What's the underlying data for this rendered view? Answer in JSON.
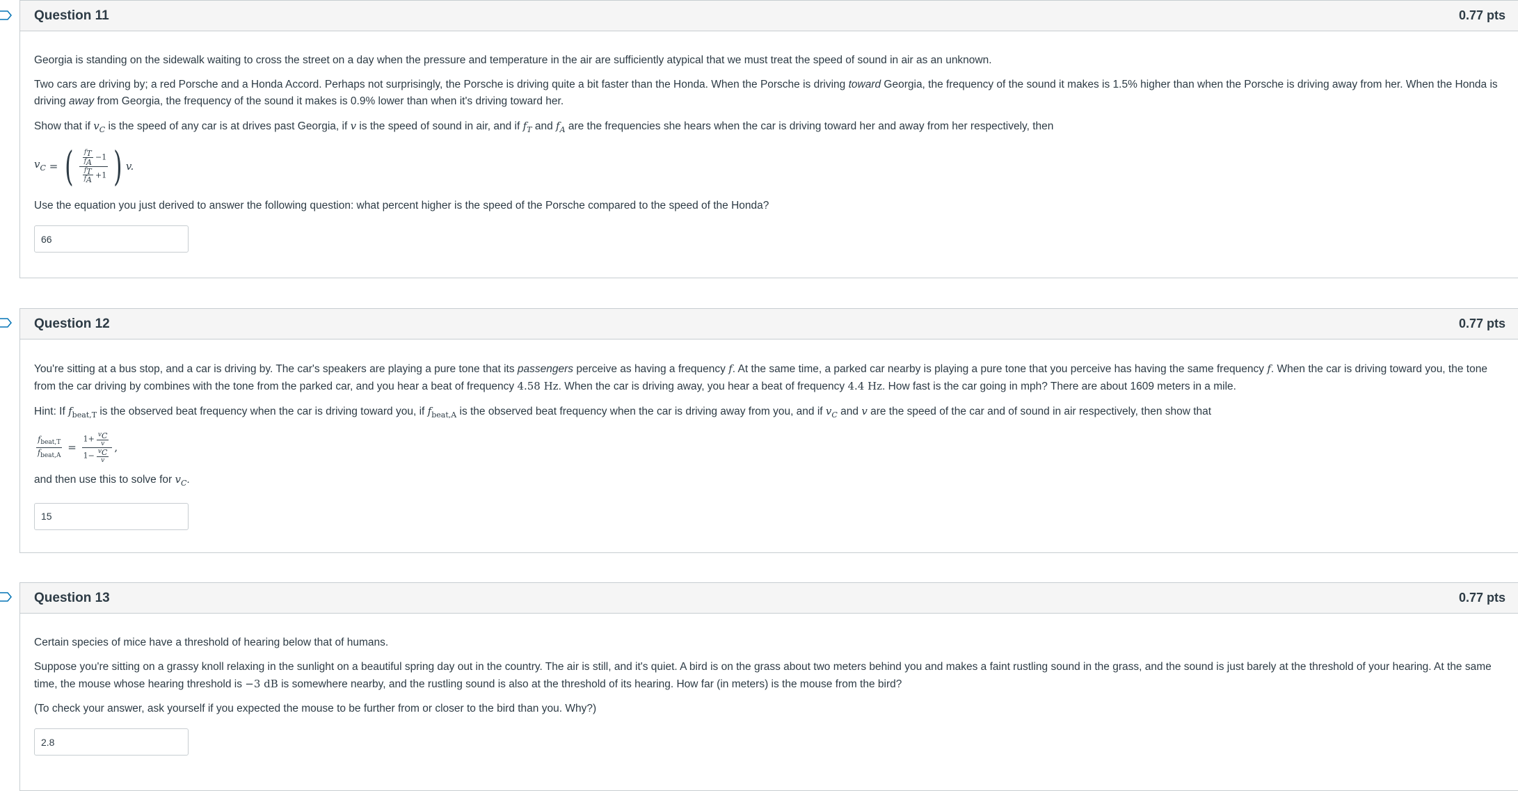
{
  "questions": [
    {
      "title": "Question 11",
      "points": "0.77 pts",
      "p1": "Georgia is standing on the sidewalk waiting to cross the street on a day when the pressure and temperature in the air are sufficiently atypical that we must treat the speed of sound in air as an unknown.",
      "p2a": "Two cars are driving by; a red Porsche and a Honda Accord.  Perhaps not surprisingly, the Porsche is driving quite a bit faster than the Honda.  When the Porsche is driving ",
      "p2_em1": "toward",
      "p2b": " Georgia, the frequency of the sound it makes is 1.5% higher than when the Porsche is driving away from her.  When the Honda is driving ",
      "p2_em2": "away",
      "p2c": " from Georgia, the frequency of the sound it makes is 0.9% lower than when it's driving toward her.",
      "p3a": "Show that if ",
      "p3b": " is the speed of any car is at drives past Georgia, if ",
      "p3c": " is the speed of sound in air, and if ",
      "p3d": " and ",
      "p3e": " are the frequencies she hears when the car is driving toward her and away from her respectively, then",
      "p4": "Use the equation you just derived to answer the following question: what percent higher is the speed of the Porsche compared to the speed of the Honda?",
      "answer": "66"
    },
    {
      "title": "Question 12",
      "points": "0.77 pts",
      "p1a": "You're sitting at a bus stop, and a car is driving by.  The car's speakers are playing a pure tone that its ",
      "p1_em": "passengers",
      "p1b": " perceive as having a frequency ",
      "p1c": ".  At the same time, a parked car nearby is playing a pure tone that you perceive has having the same frequency ",
      "p1d": ".  When the car is driving toward you, the tone from the car driving by combines with the tone from the parked car, and you hear a beat of frequency ",
      "beat1": "4.58 Hz",
      "p1e": ".  When the car is driving away, you hear a beat of frequency ",
      "beat2": "4.4 Hz",
      "p1f": ".  How fast is the car going in mph?  There are about 1609 meters in a mile.",
      "p2a": "Hint: If ",
      "p2b": " is the observed beat frequency when the car is driving toward you, if ",
      "p2c": " is the observed beat frequency when the car is driving away from you, and if ",
      "p2d": " and ",
      "p2e": " are the speed of the car and of sound in air respectively, then show that",
      "p3": "and then use this to solve for ",
      "answer": "15"
    },
    {
      "title": "Question 13",
      "points": "0.77 pts",
      "p1": "Certain species of mice have a threshold of hearing below that of humans.",
      "p2a": "Suppose you're sitting on a grassy knoll relaxing in the sunlight on a beautiful spring day out in the country.  The air is still, and it's quiet.  A bird is on the grass about two meters behind you and makes a faint rustling sound in the grass, and the sound is just barely at the threshold of your hearing.  At the same time, the mouse whose hearing threshold is ",
      "db": "−3 dB",
      "p2b": " is somewhere nearby, and the rustling sound is also at the threshold of its hearing.  How far (in meters) is the mouse from the bird?",
      "p3": "(To check your answer, ask yourself if you expected the mouse to be further from or closer to the bird than you.  Why?)",
      "answer": "2.8"
    }
  ],
  "colors": {
    "header_bg": "#f5f5f5",
    "border": "#c7cdd1",
    "text": "#2d3b45",
    "flag": "#0374b5"
  },
  "icons": {
    "flag": "bookmark-flag-icon"
  }
}
